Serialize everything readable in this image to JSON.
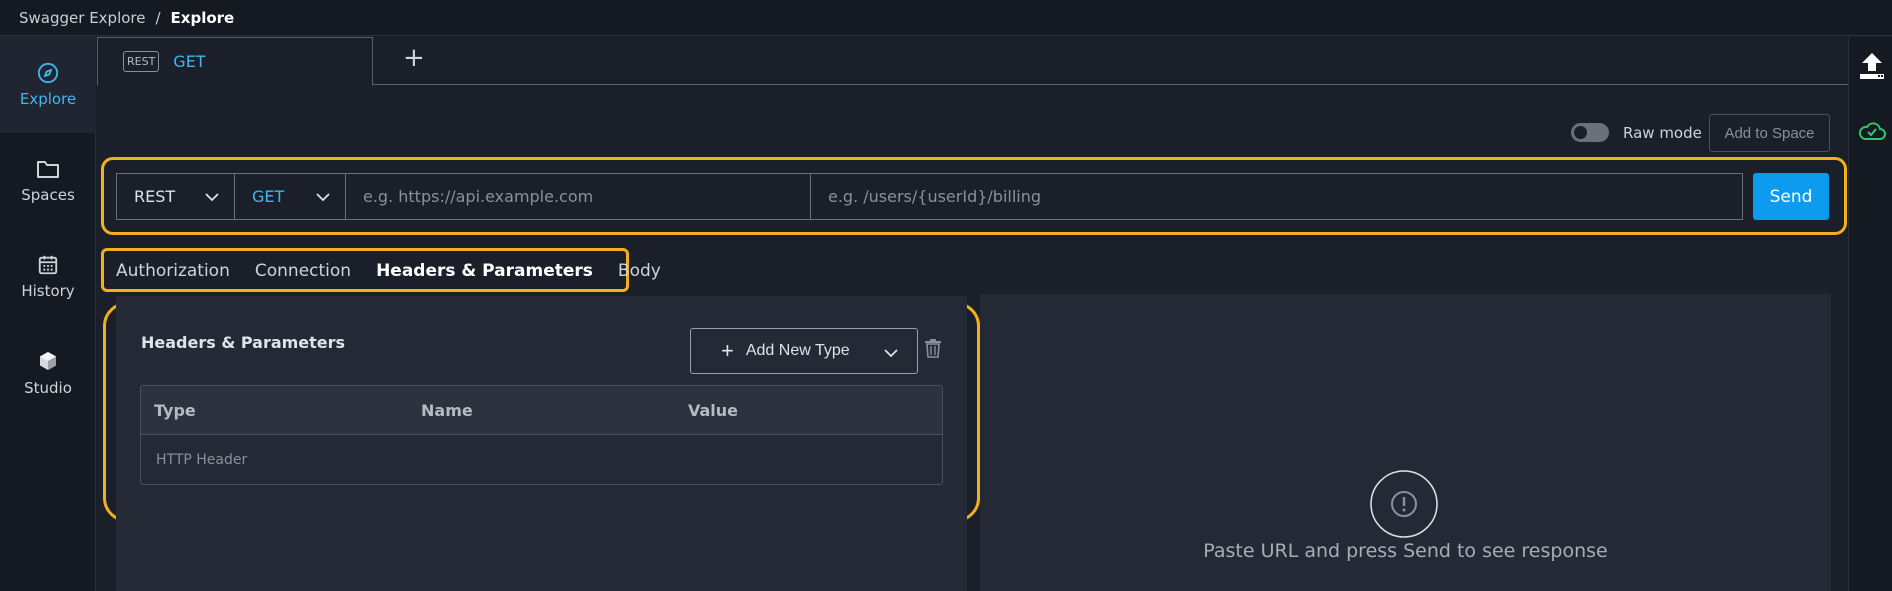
{
  "breadcrumb": {
    "root": "Swagger Explore",
    "separator": "/",
    "current": "Explore"
  },
  "nav": {
    "items": [
      {
        "label": "Explore",
        "icon": "compass-icon",
        "active": true
      },
      {
        "label": "Spaces",
        "icon": "folder-icon"
      },
      {
        "label": "History",
        "icon": "calendar-icon"
      },
      {
        "label": "Studio",
        "icon": "cube-icon"
      }
    ]
  },
  "tabs": {
    "active_badge": "REST",
    "active_label": "GET",
    "add_label": "+"
  },
  "toolbar": {
    "raw_mode_label": "Raw mode",
    "add_to_space_label": "Add to Space"
  },
  "request": {
    "protocol": "REST",
    "method": "GET",
    "base_url_placeholder": "e.g. https://api.example.com",
    "path_placeholder": "e.g. /users/{userId}/billing",
    "send_label": "Send"
  },
  "subtabs": [
    "Authorization",
    "Connection",
    "Headers & Parameters",
    "Body"
  ],
  "headers_panel": {
    "title": "Headers & Parameters",
    "add_button_label": "Add New Type",
    "columns": [
      "Type",
      "Name",
      "Value"
    ],
    "rows": [
      {
        "type": "HTTP Header",
        "name": "",
        "value": ""
      }
    ]
  },
  "response": {
    "empty_message": "Paste URL and press Send to see response"
  },
  "colors": {
    "accent": "#3fb7f0",
    "send": "#0d9bf0",
    "highlight": "#f2b01f",
    "success": "#34c46a"
  }
}
